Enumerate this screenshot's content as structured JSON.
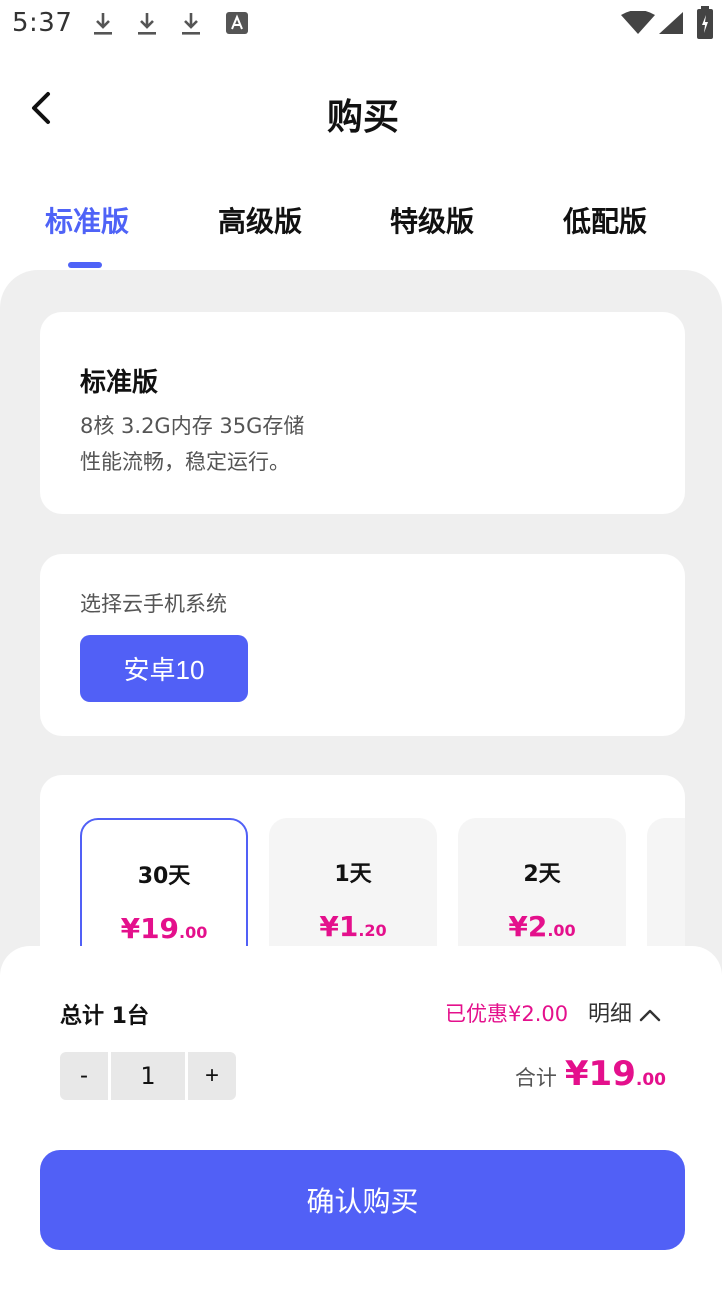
{
  "status_bar": {
    "time": "5:37",
    "icons": [
      "download-icon",
      "download-icon",
      "download-icon",
      "a-icon",
      "wifi-icon",
      "signal-icon",
      "battery-icon"
    ]
  },
  "header": {
    "title": "购买",
    "back_icon": "chevron-left-icon"
  },
  "tabs": [
    {
      "label": "标准版",
      "active": true
    },
    {
      "label": "高级版",
      "active": false
    },
    {
      "label": "特级版",
      "active": false
    },
    {
      "label": "低配版",
      "active": false
    }
  ],
  "plan": {
    "name": "标准版",
    "spec": "8核 3.2G内存 35G存储",
    "description": "性能流畅，稳定运行。"
  },
  "os_select": {
    "label": "选择云手机系统",
    "selected": "安卓10"
  },
  "durations": [
    {
      "label": "30天",
      "price_main": "¥19",
      "price_decimal": ".00",
      "selected": true
    },
    {
      "label": "1天",
      "price_main": "¥1",
      "price_decimal": ".20",
      "selected": false
    },
    {
      "label": "2天",
      "price_main": "¥2",
      "price_decimal": ".00",
      "selected": false
    }
  ],
  "summary": {
    "total_label": "总计 1台",
    "discount": "已优惠¥2.00",
    "detail_label": "明细",
    "stepper": {
      "minus": "-",
      "value": "1",
      "plus": "+"
    },
    "sum_label": "合计",
    "sum_main": "¥19",
    "sum_decimal": ".00"
  },
  "confirm_label": "确认购买",
  "colors": {
    "accent": "#5160f6",
    "tab_active": "#4f63f7",
    "price": "#e4108c",
    "background": "#efefef"
  }
}
